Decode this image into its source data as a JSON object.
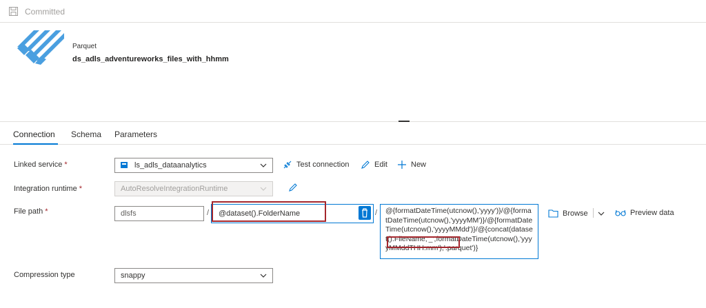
{
  "header": {
    "status": "Committed",
    "save_icon": "save-icon"
  },
  "dataset": {
    "type": "Parquet",
    "name": "ds_adls_adventureworks_files_with_hhmm",
    "icon": "parquet-icon"
  },
  "tabs": [
    {
      "label": "Connection",
      "active": true
    },
    {
      "label": "Schema",
      "active": false
    },
    {
      "label": "Parameters",
      "active": false
    }
  ],
  "linked_service": {
    "label": "Linked service",
    "required": "*",
    "value": "ls_adls_dataanalytics",
    "actions": {
      "test": "Test connection",
      "edit": "Edit",
      "new": "New"
    }
  },
  "integration_runtime": {
    "label": "Integration runtime",
    "required": "*",
    "value": "AutoResolveIntegrationRuntime"
  },
  "file_path": {
    "label": "File path",
    "required": "*",
    "container": "dlsfs",
    "separator": "/",
    "folder": "@dataset().FolderName",
    "file_expression": "@{formatDateTime(utcnow(),'yyyy')}/@{formatDateTime(utcnow(),'yyyyMM')}/@{formatDateTime(utcnow(),'yyyyMMdd')}/@{concat(dataset().FileName,'_',formatDateTime(utcnow(),'yyyyMMddTHH:mm'),'.parquet')}",
    "browse": "Browse",
    "preview": "Preview data"
  },
  "compression": {
    "label": "Compression type",
    "value": "snappy"
  },
  "colors": {
    "accent": "#0078d4",
    "highlight": "#a4262c",
    "icon_blue": "#4a9fe0"
  }
}
